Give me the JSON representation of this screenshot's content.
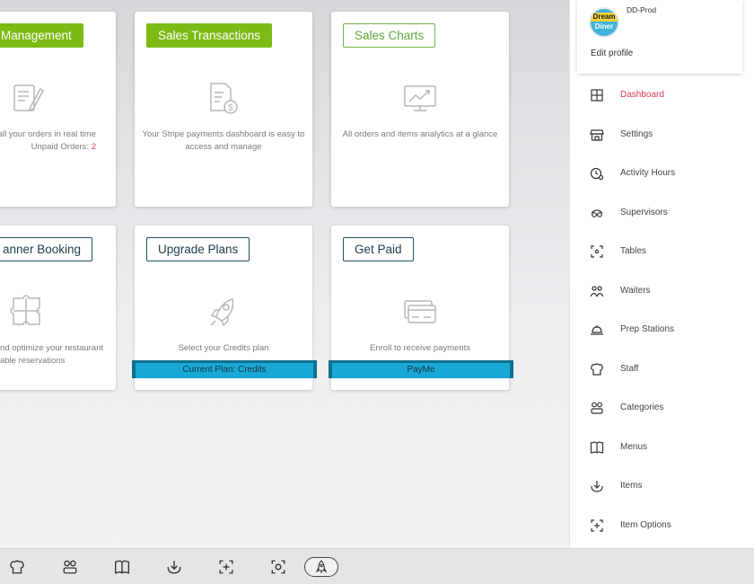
{
  "cards": [
    {
      "title": "Management",
      "desc_lines": [
        "of all your orders in real time",
        "Unpaid Orders: "
      ],
      "unpaid_count": "2",
      "icon": "order-form-icon"
    },
    {
      "title": "Sales Transactions",
      "desc_lines": [
        "Your Stripe payments dashboard is easy to",
        "access and manage"
      ],
      "icon": "invoice-dollar-icon"
    },
    {
      "title": "Sales Charts",
      "desc_lines": [
        "All orders and items analytics at a glance"
      ],
      "icon": "analytics-monitor-icon"
    },
    {
      "title": "anner Booking",
      "desc_lines": [
        "nd optimize your restaurant",
        "able reservations"
      ],
      "icon": "puzzle-icon"
    },
    {
      "title": "Upgrade Plans",
      "desc_lines": [
        "Select your Credits plan"
      ],
      "bar": "Current Plan: Credits",
      "icon": "rocket-icon"
    },
    {
      "title": "Get Paid",
      "desc_lines": [
        "Enroll to receive payments"
      ],
      "bar": "PayMe",
      "icon": "credit-card-icon"
    }
  ],
  "profile": {
    "avatar_line1": "Dream",
    "avatar_line2": "Diner",
    "name": "DD-Prod",
    "edit_label": "Edit profile"
  },
  "nav": [
    {
      "label": "Dashboard",
      "icon": "dashboard-icon",
      "active": true
    },
    {
      "label": "Settings",
      "icon": "store-icon"
    },
    {
      "label": "Activity Hours",
      "icon": "clock-icon"
    },
    {
      "label": "Supervisors",
      "icon": "supervisor-icon"
    },
    {
      "label": "Tables",
      "icon": "table-icon"
    },
    {
      "label": "Waiters",
      "icon": "waiters-icon"
    },
    {
      "label": "Prep Stations",
      "icon": "cloche-icon"
    },
    {
      "label": "Staff",
      "icon": "chef-hat-icon"
    },
    {
      "label": "Categories",
      "icon": "categories-icon"
    },
    {
      "label": "Menus",
      "icon": "menu-book-icon"
    },
    {
      "label": "Items",
      "icon": "items-icon"
    },
    {
      "label": "Item Options",
      "icon": "item-options-icon"
    }
  ],
  "bottombar": [
    "chef-hat-icon",
    "categories-icon",
    "menu-book-icon",
    "items-icon",
    "item-options-icon",
    "scan-icon",
    "rocket-icon"
  ],
  "colors": {
    "accent_red": "#e0384f",
    "green": "#7cbb16",
    "plan_bar": "#19a8d6",
    "dark_border": "#1f4f63"
  }
}
